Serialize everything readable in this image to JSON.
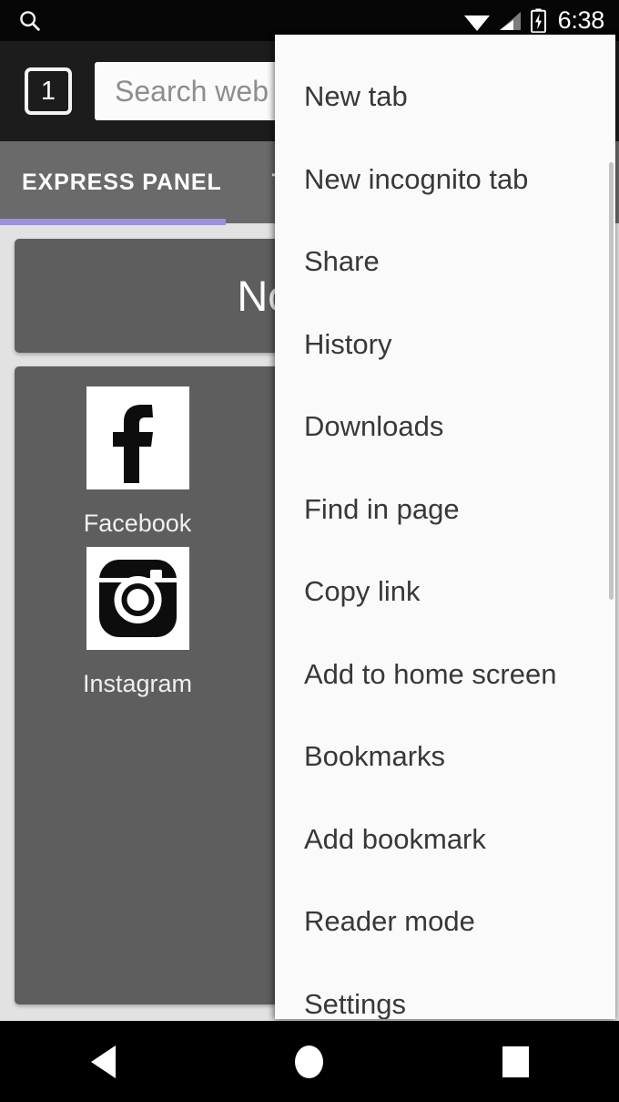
{
  "status_bar": {
    "search_icon": "search-icon",
    "wifi_icon": "wifi-icon",
    "signal_icon": "cellular-signal-icon",
    "battery_icon": "battery-charging-icon",
    "time": "6:38"
  },
  "toolbar": {
    "tab_count": "1",
    "omnibox_placeholder": "Search web"
  },
  "tabs": {
    "items": [
      {
        "label": "EXPRESS PANEL",
        "active": true
      },
      {
        "label": "TO",
        "active": false
      }
    ],
    "indicator_color": "#9a90dd"
  },
  "content": {
    "weather_card": {
      "text": "No wea"
    },
    "shortcuts": [
      {
        "label": "Facebook",
        "icon": "facebook-icon"
      },
      {
        "label": "",
        "icon": "partial-icon-1"
      },
      {
        "label": "Instagram",
        "icon": "instagram-icon"
      },
      {
        "label": "",
        "icon": "partial-icon-2"
      }
    ]
  },
  "overflow_menu": {
    "items": [
      "New tab",
      "New incognito tab",
      "Share",
      "History",
      "Downloads",
      "Find in page",
      "Copy link",
      "Add to home screen",
      "Bookmarks",
      "Add bookmark",
      "Reader mode",
      "Settings"
    ],
    "background": "#fafafa",
    "text_color": "#38383a"
  },
  "nav_bar": {
    "back_label": "Back",
    "home_label": "Home",
    "recents_label": "Recents"
  }
}
